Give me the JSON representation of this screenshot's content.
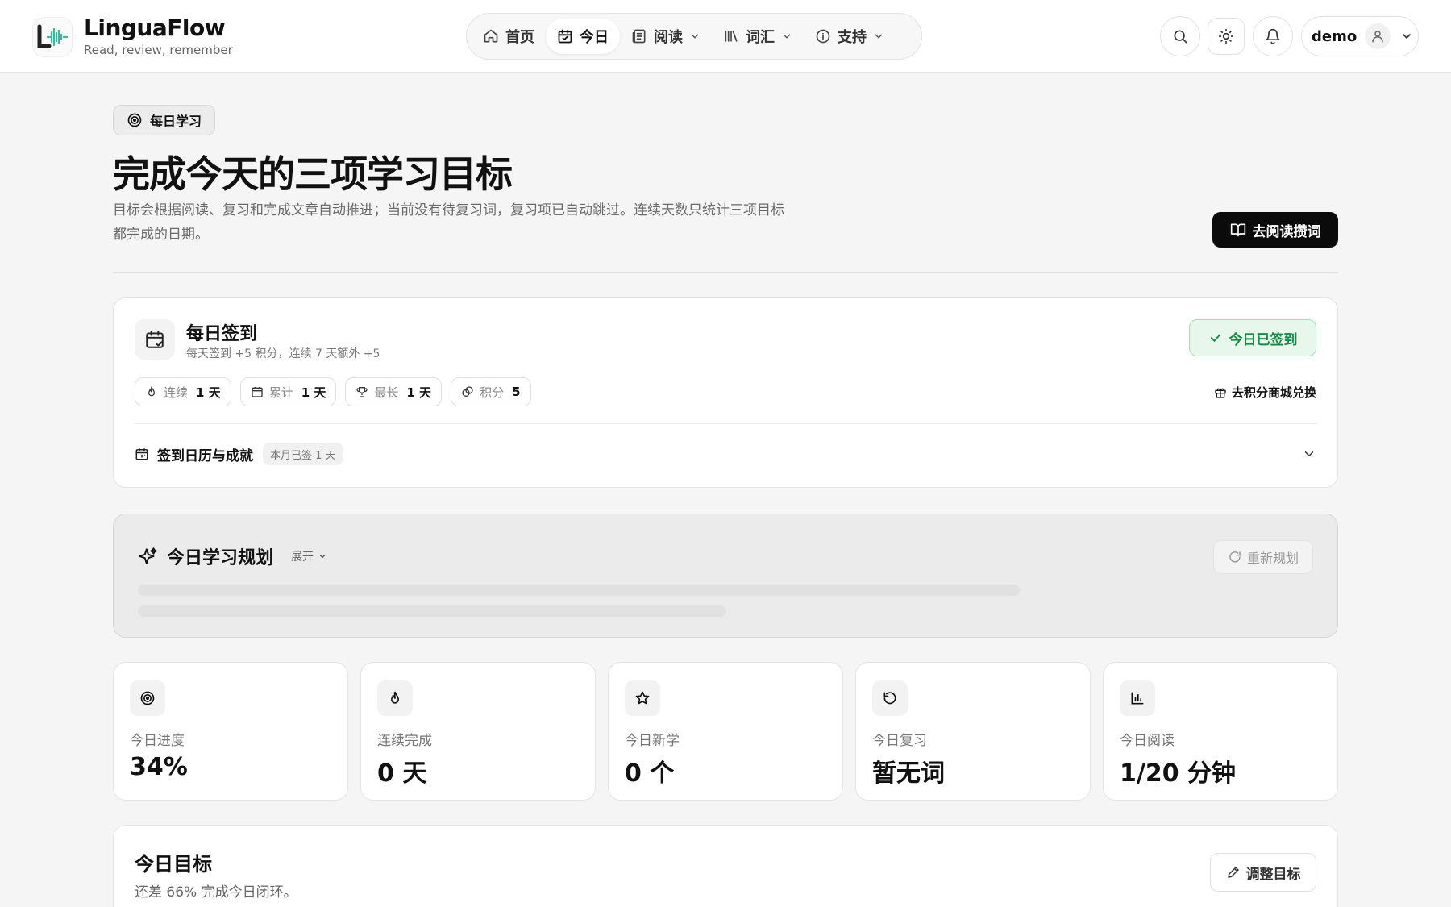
{
  "brand": {
    "name": "LinguaFlow",
    "tagline": "Read, review, remember",
    "accent": "#3fb59e"
  },
  "nav": {
    "items": [
      {
        "label": "首页",
        "icon": "home-icon",
        "active": false
      },
      {
        "label": "今日",
        "icon": "calendar-check-icon",
        "active": true
      },
      {
        "label": "阅读",
        "icon": "newspaper-icon",
        "dropdown": true
      },
      {
        "label": "词汇",
        "icon": "library-icon",
        "dropdown": true
      },
      {
        "label": "支持",
        "icon": "info-icon",
        "dropdown": true
      }
    ]
  },
  "header": {
    "user": "demo"
  },
  "hero": {
    "badge": "每日学习",
    "title": "完成今天的三项学习目标",
    "description": "目标会根据阅读、复习和完成文章自动推进；当前没有待复习词，复习项已自动跳过。连续天数只统计三项目标都完成的日期。",
    "cta": "去阅读攒词"
  },
  "checkin": {
    "title": "每日签到",
    "subtitle": "每天签到 +5 积分，连续 7 天额外 +5",
    "status": "今日已签到",
    "status_color": "#178a45",
    "chips": [
      {
        "label": "连续",
        "value": "1 天",
        "icon": "flame-icon"
      },
      {
        "label": "累计",
        "value": "1 天",
        "icon": "calendar-icon"
      },
      {
        "label": "最长",
        "value": "1 天",
        "icon": "trophy-icon"
      },
      {
        "label": "积分",
        "value": "5",
        "icon": "coins-icon"
      }
    ],
    "shop_link": "去积分商城兑换",
    "calendar_title": "签到日历与成就",
    "calendar_badge": "本月已签 1 天"
  },
  "plan": {
    "title": "今日学习规划",
    "expand": "展开",
    "replan": "重新规划"
  },
  "stats": [
    {
      "label": "今日进度",
      "value": "34%",
      "icon": "target-icon"
    },
    {
      "label": "连续完成",
      "value": "0 天",
      "icon": "flame-icon"
    },
    {
      "label": "今日新学",
      "value": "0 个",
      "icon": "star-icon"
    },
    {
      "label": "今日复习",
      "value": "暂无词",
      "icon": "rotate-ccw-icon"
    },
    {
      "label": "今日阅读",
      "value": "1/20 分钟",
      "icon": "bar-chart-icon"
    }
  ],
  "goal": {
    "title": "今日目标",
    "subtitle": "还差 66% 完成今日闭环。",
    "adjust": "调整目标"
  }
}
